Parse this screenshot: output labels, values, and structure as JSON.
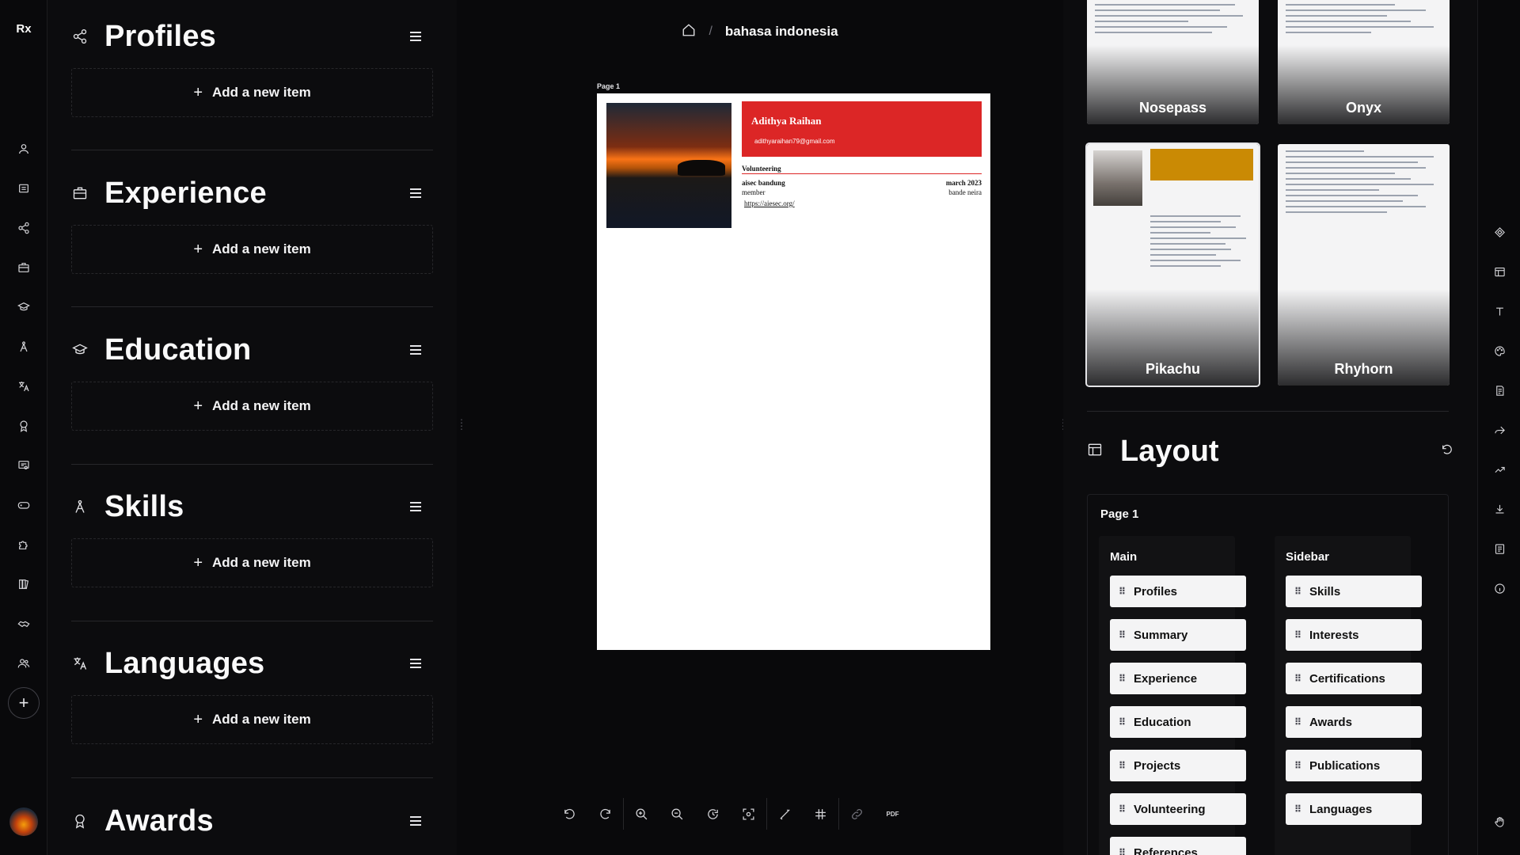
{
  "app": {
    "logo": "Rx"
  },
  "left_rail": {
    "icons": [
      "user-icon",
      "summary-icon",
      "share-icon",
      "briefcase-icon",
      "graduation-cap-icon",
      "skills-icon",
      "languages-icon",
      "award-icon",
      "certificate-icon",
      "gamepad-icon",
      "puzzle-icon",
      "books-icon",
      "handshake-icon",
      "users-icon"
    ],
    "add_label": "+"
  },
  "sections": [
    {
      "id": "profiles",
      "title": "Profiles",
      "icon": "share-icon",
      "add_label": "Add a new item"
    },
    {
      "id": "experience",
      "title": "Experience",
      "icon": "briefcase-icon",
      "add_label": "Add a new item"
    },
    {
      "id": "education",
      "title": "Education",
      "icon": "graduation-cap-icon",
      "add_label": "Add a new item"
    },
    {
      "id": "skills",
      "title": "Skills",
      "icon": "skills-icon",
      "add_label": "Add a new item"
    },
    {
      "id": "languages",
      "title": "Languages",
      "icon": "languages-icon",
      "add_label": "Add a new item"
    },
    {
      "id": "awards",
      "title": "Awards",
      "icon": "award-icon",
      "add_label": ""
    }
  ],
  "header": {
    "breadcrumb_sep": "/",
    "title": "bahasa indonesia"
  },
  "resume": {
    "page_label": "Page 1",
    "name": "Adithya Raihan",
    "email": "adithyaraihan79@gmail.com",
    "accent": "#dc2626",
    "volunteering": {
      "heading": "Volunteering",
      "organization": "aisec bandung",
      "date": "march 2023",
      "position": "member",
      "location": "bande neira",
      "url": "https://aiesec.org/"
    }
  },
  "zoom_toolbar": {
    "buttons": [
      "undo-icon",
      "redo-icon",
      "zoom-in-icon",
      "zoom-out-icon",
      "reset-zoom-icon",
      "center-icon",
      "ruler-icon",
      "grid-icon",
      "link-icon",
      "pdf-icon"
    ],
    "pdf_label": "PDF"
  },
  "templates": [
    {
      "name": "Nosepass"
    },
    {
      "name": "Onyx"
    },
    {
      "name": "Pikachu",
      "selected": true
    },
    {
      "name": "Rhyhorn"
    }
  ],
  "layout": {
    "title": "Layout",
    "page_label": "Page 1",
    "main": {
      "title": "Main",
      "items": [
        "Profiles",
        "Summary",
        "Experience",
        "Education",
        "Projects",
        "Volunteering",
        "References"
      ]
    },
    "sidebar": {
      "title": "Sidebar",
      "items": [
        "Skills",
        "Interests",
        "Certifications",
        "Awards",
        "Publications",
        "Languages"
      ]
    }
  },
  "right_rail": {
    "icons": [
      "template-icon",
      "layout-icon",
      "typography-icon",
      "theme-icon",
      "page-icon",
      "share-icon",
      "statistics-icon",
      "download-icon",
      "notes-icon",
      "info-icon",
      "hand-icon"
    ]
  }
}
